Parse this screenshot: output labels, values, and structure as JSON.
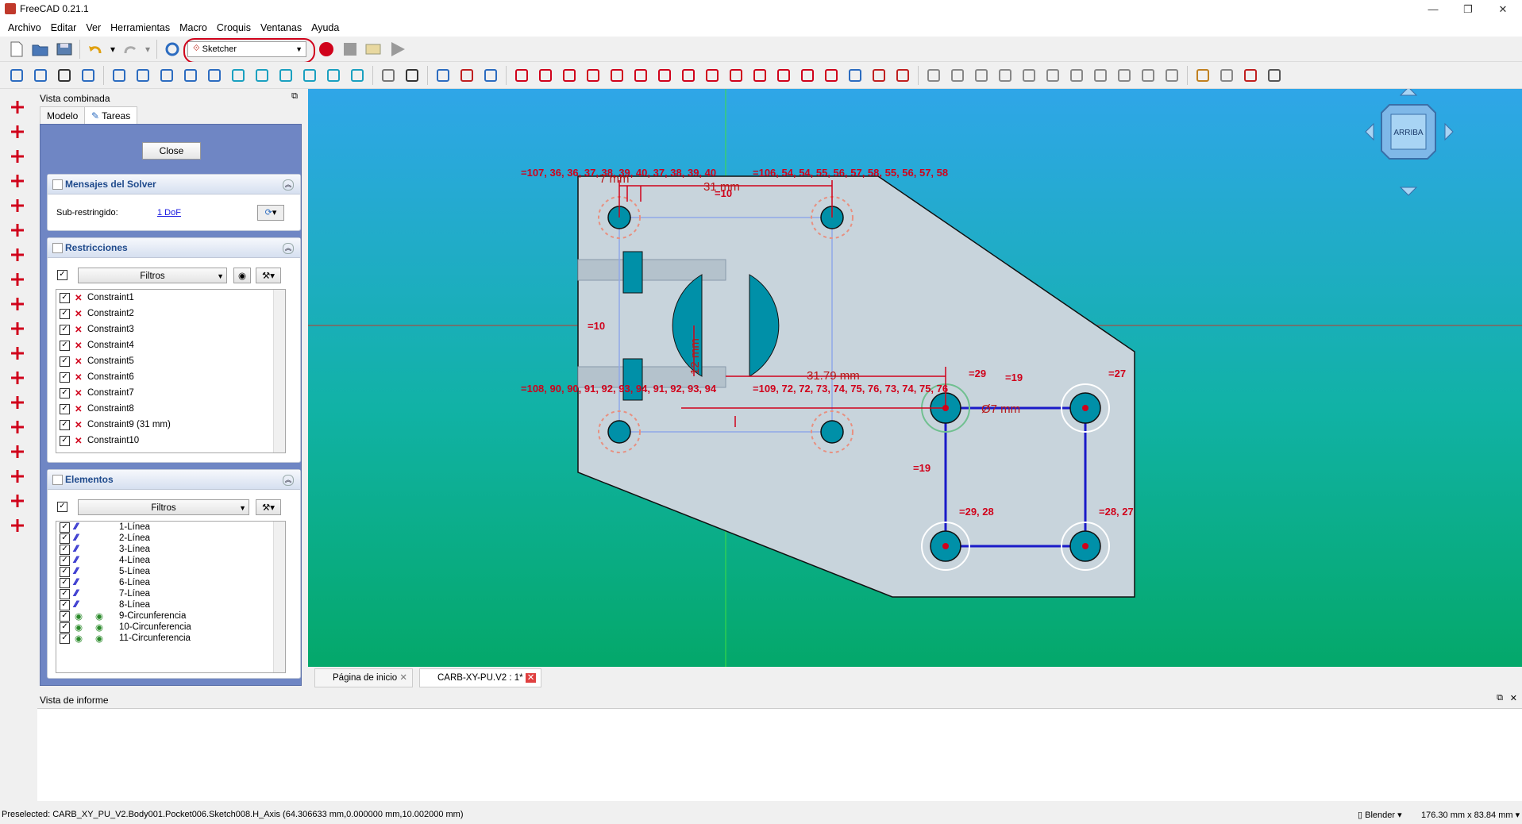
{
  "window": {
    "title": "FreeCAD 0.21.1",
    "min": "—",
    "max": "❐",
    "close": "✕"
  },
  "menu": [
    "Archivo",
    "Editar",
    "Ver",
    "Herramientas",
    "Macro",
    "Croquis",
    "Ventanas",
    "Ayuda"
  ],
  "toolbar": {
    "workbench": "Sketcher"
  },
  "combo": {
    "title": "Vista combinada",
    "tabs": [
      "Modelo",
      "Tareas"
    ],
    "close_label": "Close",
    "solver": {
      "title": "Mensajes del Solver",
      "label": "Sub-restringido:",
      "link": "1 DoF"
    },
    "constraints": {
      "title": "Restricciones",
      "filter": "Filtros",
      "items": [
        "Constraint1",
        "Constraint2",
        "Constraint3",
        "Constraint4",
        "Constraint5",
        "Constraint6",
        "Constraint7",
        "Constraint8",
        "Constraint9 (31 mm)",
        "Constraint10"
      ]
    },
    "elements": {
      "title": "Elementos",
      "filter": "Filtros",
      "items": [
        "1-Línea",
        "2-Línea",
        "3-Línea",
        "4-Línea",
        "5-Línea",
        "6-Línea",
        "7-Línea",
        "8-Línea",
        "9-Circunferencia",
        "10-Circunferencia",
        "11-Circunferencia"
      ]
    }
  },
  "viewport": {
    "navcube_face": "ARRIBA",
    "labels": {
      "top_left": "=107, 36, 36, 37, 38, 39, 40, 37, 38, 39, 40",
      "top_right": "=106, 54, 54, 55, 56, 57, 58, 55, 56, 57, 58",
      "dim_31": "31 mm",
      "eq10_a": "=10",
      "eq10_b": "=10",
      "dim_7": "7 mm",
      "dim_12": "12 mm",
      "dim_3179": "31.79 mm",
      "bottom_left": "=108, 90, 90, 91, 92, 93, 94, 91, 92, 93, 94",
      "bottom_right": "=109, 72, 72, 73, 74, 75, 76, 73, 74, 75, 76",
      "eq29": "=29",
      "eq19a": "=19",
      "eq27": "=27",
      "diam7": "Ø7 mm",
      "eq19b": "=19",
      "eq2928": "=29, 28",
      "eq2827": "=28, 27"
    }
  },
  "doc_tabs": [
    "Página de inicio",
    "CARB-XY-PU.V2 : 1*"
  ],
  "report": {
    "title": "Vista de informe"
  },
  "status": {
    "preselected": "Preselected: CARB_XY_PU_V2.Body001.Pocket006.Sketch008.H_Axis (64.306633 mm,0.000000 mm,10.002000 mm)",
    "nav_style": "Blender",
    "dimensions": "176.30 mm x 83.84 mm"
  },
  "colors": {
    "accent": "#d0021b",
    "sketch_blue": "#1a1ac8",
    "hole_fill": "#0090a8"
  }
}
